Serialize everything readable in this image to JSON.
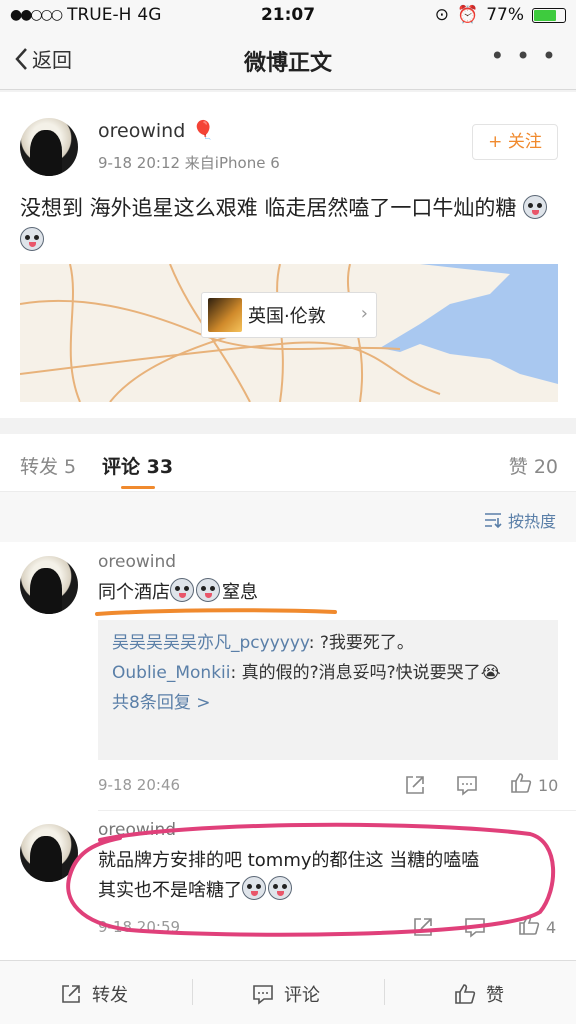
{
  "status": {
    "carrier": "TRUE-H",
    "network": "4G",
    "time": "21:07",
    "battery": "77%",
    "battery_level": 0.77
  },
  "nav": {
    "back_label": "返回",
    "title": "微博正文"
  },
  "post": {
    "username": "oreowind",
    "meta": "9-18 20:12  来自iPhone 6",
    "follow_label": "+ 关注",
    "text": "没想到 海外追星这么艰难 临走居然嗑了一口牛灿的糖",
    "location": "英国·伦敦"
  },
  "tabs": {
    "repost": "转发 5",
    "comment": "评论 33",
    "like": "赞 20"
  },
  "sort_label": "按热度",
  "comments": [
    {
      "username": "oreowind",
      "text_a": "同个酒店",
      "text_b": "窒息",
      "replies": [
        {
          "name": "吴吴吴吴吴亦凡_pcyyyyy",
          "text": ": ?我要死了。"
        },
        {
          "name": "Oublie_Monkii",
          "text": ": 真的假的?消息妥吗?快说要哭了"
        }
      ],
      "more_replies": "共8条回复 >",
      "time": "9-18 20:46",
      "likes": "10"
    },
    {
      "username": "oreowind",
      "line1": "就品牌方安排的吧 tommy的都住这 当糖的嗑嗑",
      "line2": "其实也不是啥糖了",
      "time": "9-18 20:59",
      "likes": "4"
    }
  ],
  "bottom": {
    "repost": "转发",
    "comment": "评论",
    "like": "赞"
  },
  "colors": {
    "accent": "#f08a2e",
    "link": "#5a7fa8",
    "circle": "#e0407a"
  }
}
